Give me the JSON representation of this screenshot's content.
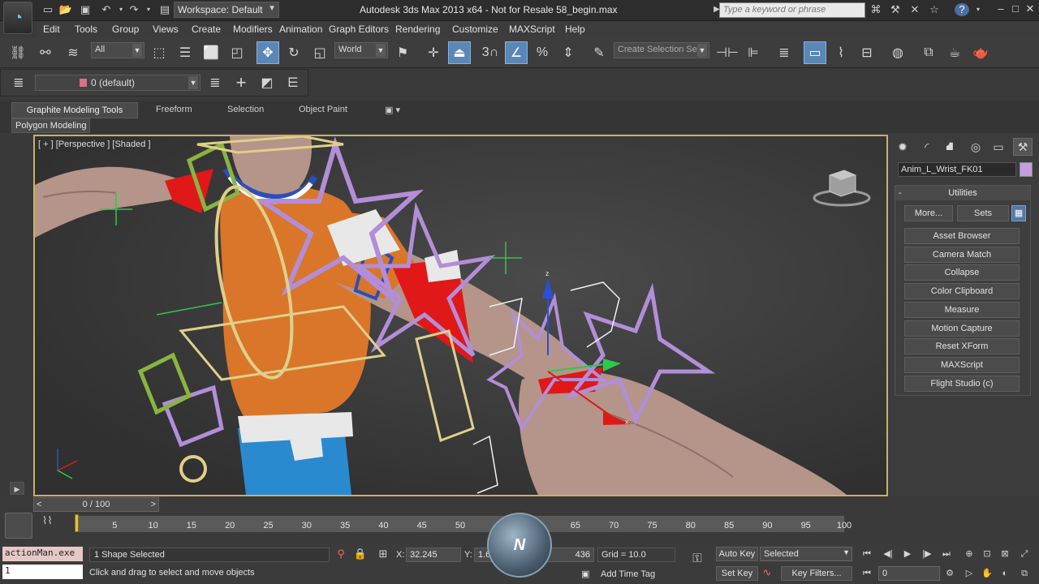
{
  "title_bar": {
    "workspace_label": "Workspace: Default",
    "app_title": "Autodesk 3ds Max  2013 x64  - Not for Resale   58_begin.max",
    "search_placeholder": "Type a keyword or phrase"
  },
  "menu": [
    "Edit",
    "Tools",
    "Group",
    "Views",
    "Create",
    "Modifiers",
    "Animation",
    "Graph Editors",
    "Rendering",
    "Customize",
    "MAXScript",
    "Help"
  ],
  "main_toolbar": {
    "selection_filter": "All",
    "reference_coord": "World",
    "snap_toggle": "3",
    "named_selection": "Create Selection Se"
  },
  "layer_toolbar": {
    "current_layer": "0 (default)"
  },
  "ribbon": {
    "tabs": [
      "Graphite Modeling Tools",
      "Freeform",
      "Selection",
      "Object Paint"
    ],
    "active_tab": "Graphite Modeling Tools",
    "panel": "Polygon Modeling"
  },
  "viewport": {
    "label": "[ + ] [Perspective ] [Shaded ]"
  },
  "command_panel": {
    "object_name": "Anim_L_Wrist_FK01",
    "object_color": "#c49ee0",
    "rollout_title": "Utilities",
    "rollout_toggle": "-",
    "more_button": "More...",
    "sets_button": "Sets",
    "utilities": [
      "Asset Browser",
      "Camera Match",
      "Collapse",
      "Color Clipboard",
      "Measure",
      "Motion Capture",
      "Reset XForm",
      "MAXScript",
      "Flight Studio (c)"
    ]
  },
  "time_slider": {
    "value": "0 / 100",
    "prev": "<",
    "next": ">"
  },
  "track_bar": {
    "ticks": [
      5,
      10,
      15,
      20,
      25,
      30,
      35,
      40,
      45,
      50,
      65,
      70,
      75,
      80,
      85,
      90,
      95,
      100
    ],
    "range_max": 100
  },
  "status_bar": {
    "maxscript_listener": "actionMan.exe",
    "maxscript_line": "1",
    "selection_info": "1 Shape Selected",
    "prompt": "Click and drag to select and move objects",
    "x_label": "X:",
    "x_value": "32.245",
    "y_label": "Y:",
    "y_value": "1.67",
    "z_label": "Z:",
    "z_value": "436",
    "grid": "Grid = 10.0",
    "add_time_tag": "Add Time Tag",
    "auto_key": "Auto Key",
    "set_key": "Set Key",
    "selection_set": "Selected",
    "key_filters": "Key Filters...",
    "current_frame": "0"
  },
  "colors": {
    "accent_active": "#5a87b8",
    "viewport_border": "#c9b06a"
  }
}
